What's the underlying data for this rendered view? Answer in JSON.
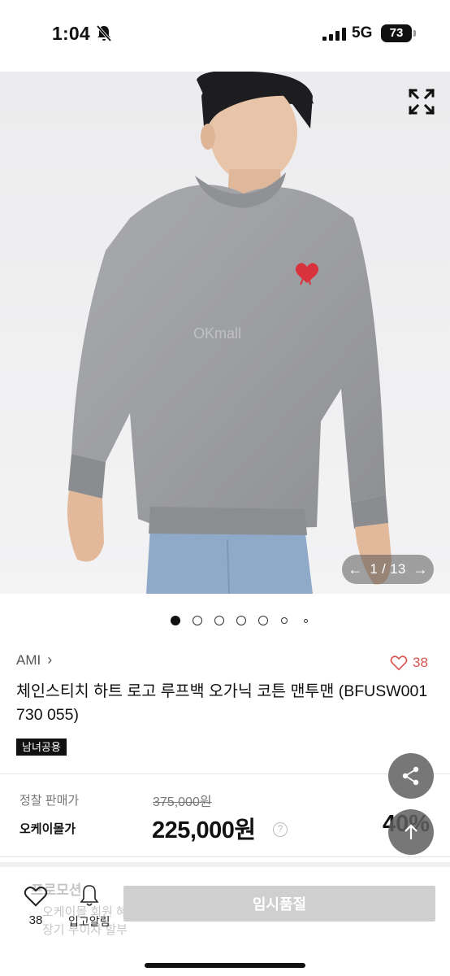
{
  "status_bar": {
    "time": "1:04",
    "network": "5G",
    "battery": "73"
  },
  "gallery": {
    "counter": "1 / 13",
    "watermark": "OKmall",
    "current_index": 1,
    "total": 13
  },
  "product": {
    "brand": "AMI",
    "like_count": "38",
    "title": "체인스티치 하트 로고 루프백 오가닉 코튼 맨투맨 (BFUSW001 730 055)",
    "gender_badge": "남녀공용"
  },
  "price": {
    "list_label": "정찰 판매가",
    "list_price": "375,000원",
    "seller_label": "오케이몰가",
    "sale_price": "225,000원",
    "discount": "40%",
    "info_icon": "?"
  },
  "promotion": {
    "title": "프로모션",
    "line1": "오케이몰 회원 혜택",
    "line2": "장기 무이자 할부"
  },
  "bottom_bar": {
    "like_count": "38",
    "restock_label": "입고알림",
    "soldout_label": "임시품절"
  },
  "colors": {
    "heart": "#d9534f",
    "soldout_button": "#cfcfcf",
    "fab": "#5f5f5f"
  },
  "icons": [
    "bell-slash-icon",
    "signal-icon",
    "expand-icon",
    "arrow-left-icon",
    "arrow-right-icon",
    "heart-icon",
    "share-icon",
    "arrow-up-icon",
    "bell-icon"
  ]
}
